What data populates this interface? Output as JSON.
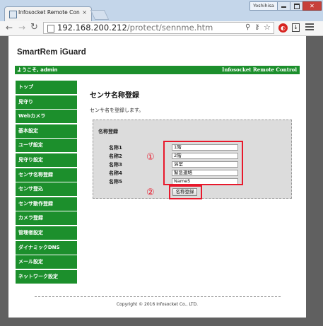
{
  "browser": {
    "tab_title": "Infosocket Remote Con",
    "tab_close": "×",
    "user_badge": "Yoshihisa",
    "url_host": "192.168.200.212",
    "url_path": "/protect/sennme.htm",
    "icons": [
      "back-arrow-icon",
      "forward-arrow-icon",
      "reload-icon",
      "page-icon",
      "zoom-icon",
      "key-icon",
      "star-icon",
      "ext-icon",
      "download-icon",
      "menu-icon"
    ]
  },
  "site": {
    "brand": "SmartRem iGuard",
    "welcome": "ようこそ, admin",
    "product": "Infosocket Remote Control",
    "accent_color": "#1c8f2c"
  },
  "sidebar": {
    "items": [
      {
        "label": "トップ"
      },
      {
        "label": "見守り"
      },
      {
        "label": "Webカメラ"
      },
      {
        "label": "基本設定"
      },
      {
        "label": "ユーザ設定"
      },
      {
        "label": "見守り設定"
      },
      {
        "label": "センサ名称登録"
      },
      {
        "label": "センサ登込"
      },
      {
        "label": "センサ動作登録"
      },
      {
        "label": "カメラ登録"
      },
      {
        "label": "管理者設定"
      },
      {
        "label": "ダイナミックDNS"
      },
      {
        "label": "メール設定"
      },
      {
        "label": "ネットワーク設定"
      }
    ]
  },
  "main": {
    "title": "センサ名称登録",
    "description": "センサ名を登録します。",
    "form": {
      "title": "名称登録",
      "fields": [
        {
          "label": "名称1",
          "value": "1階"
        },
        {
          "label": "名称2",
          "value": "2階"
        },
        {
          "label": "名称3",
          "value": "浴室"
        },
        {
          "label": "名称4",
          "value": "緊急連絡"
        },
        {
          "label": "名称5",
          "value": "Name5"
        }
      ],
      "submit_label": "名称登録"
    },
    "annotations": {
      "marker1": "①",
      "marker2": "②",
      "highlight_color": "#e8192c"
    }
  },
  "footer": {
    "copyright": "Copyright © 2016 Infosocket Co., LTD."
  }
}
